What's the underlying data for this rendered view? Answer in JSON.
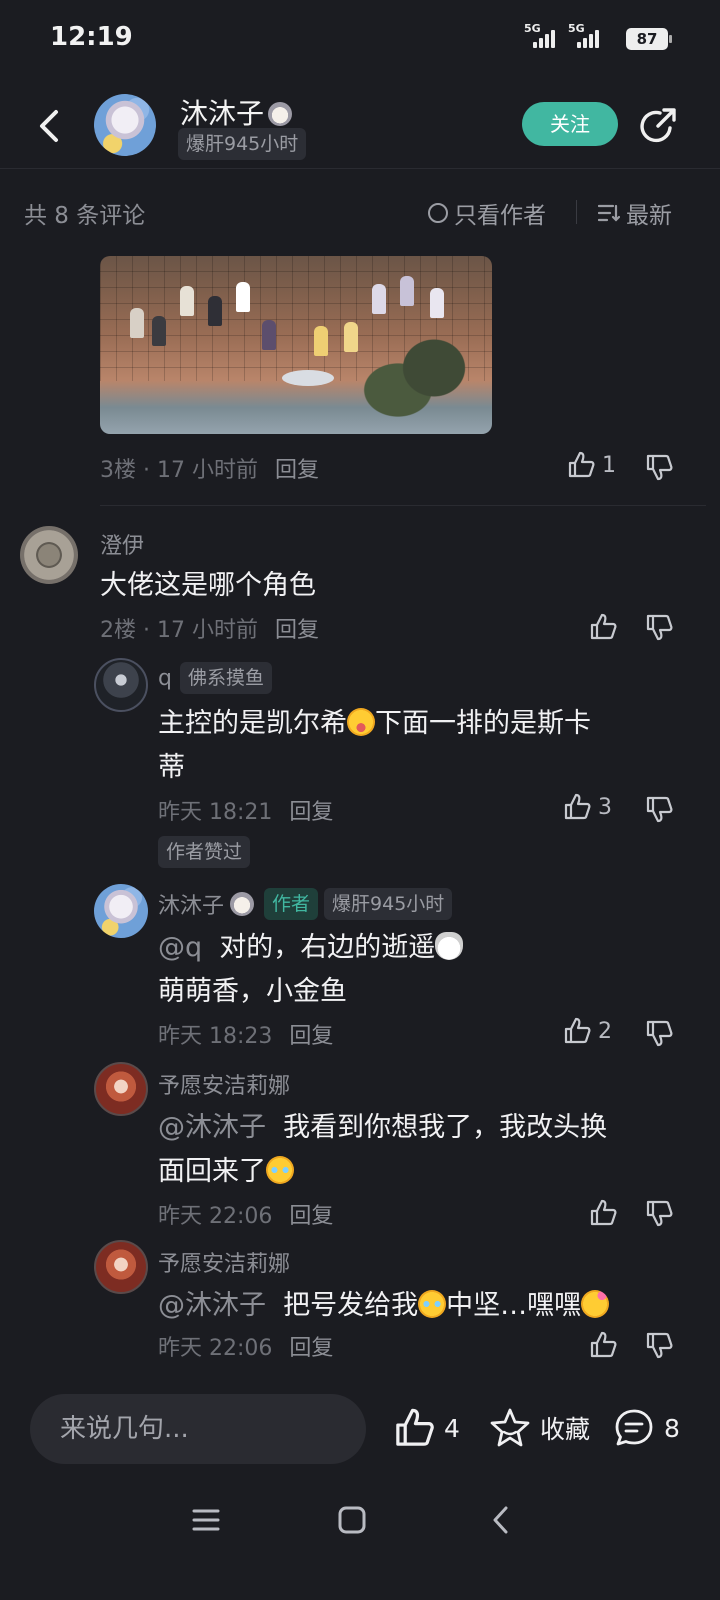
{
  "status_bar": {
    "time": "12:19",
    "signal_1": "5G",
    "signal_2": "5G",
    "battery": "87"
  },
  "header": {
    "username": "沐沐子",
    "badge": "爆肝945小时",
    "follow_label": "关注"
  },
  "filter_bar": {
    "count_text": "共 8 条评论",
    "author_only_label": "只看作者",
    "sort_label": "最新"
  },
  "top_comment": {
    "floor": "3楼",
    "time": "17 小时前",
    "reply_label": "回复",
    "likes": "1"
  },
  "comments": [
    {
      "name": "澄伊",
      "text": "大佬这是哪个角色",
      "floor": "2楼",
      "time": "17 小时前",
      "reply_label": "回复",
      "replies": [
        {
          "name": "q",
          "badge": "佛系摸鱼",
          "text_a": "主控的是凯尔希",
          "text_b": "下面一排的是斯卡",
          "text_c": "蒂",
          "time": "昨天 18:21",
          "reply_label": "回复",
          "likes": "3",
          "liked_by_author": "作者赞过"
        },
        {
          "name": "沐沐子",
          "author_tag": "作者",
          "badge": "爆肝945小时",
          "mention": "@q",
          "text_a": "对的，右边的逝遥",
          "text_b": "萌萌香，小金鱼",
          "time": "昨天 18:23",
          "reply_label": "回复",
          "likes": "2"
        },
        {
          "name": "予愿安洁莉娜",
          "mention": "@沐沐子",
          "text_a": "我看到你想我了，我改头换",
          "text_b": "面回来了",
          "time": "昨天 22:06",
          "reply_label": "回复"
        },
        {
          "name": "予愿安洁莉娜",
          "mention": "@沐沐子",
          "text_a": "把号发给我",
          "text_b": "中坚…嘿嘿",
          "time": "昨天 22:06",
          "reply_label": "回复"
        }
      ]
    }
  ],
  "bottom_bar": {
    "input_placeholder": "来说几句...",
    "likes": "4",
    "collect_label": "收藏",
    "comments": "8"
  },
  "colors": {
    "background": "#1b1c21",
    "accent": "#41b7a1",
    "muted": "#8c8e95"
  },
  "icons": [
    "back-icon",
    "share-icon",
    "circle-icon",
    "sort-icon",
    "thumb-up-icon",
    "thumb-down-icon",
    "star-icon",
    "comment-icon",
    "menu-icon",
    "home-icon",
    "nav-back-icon"
  ]
}
